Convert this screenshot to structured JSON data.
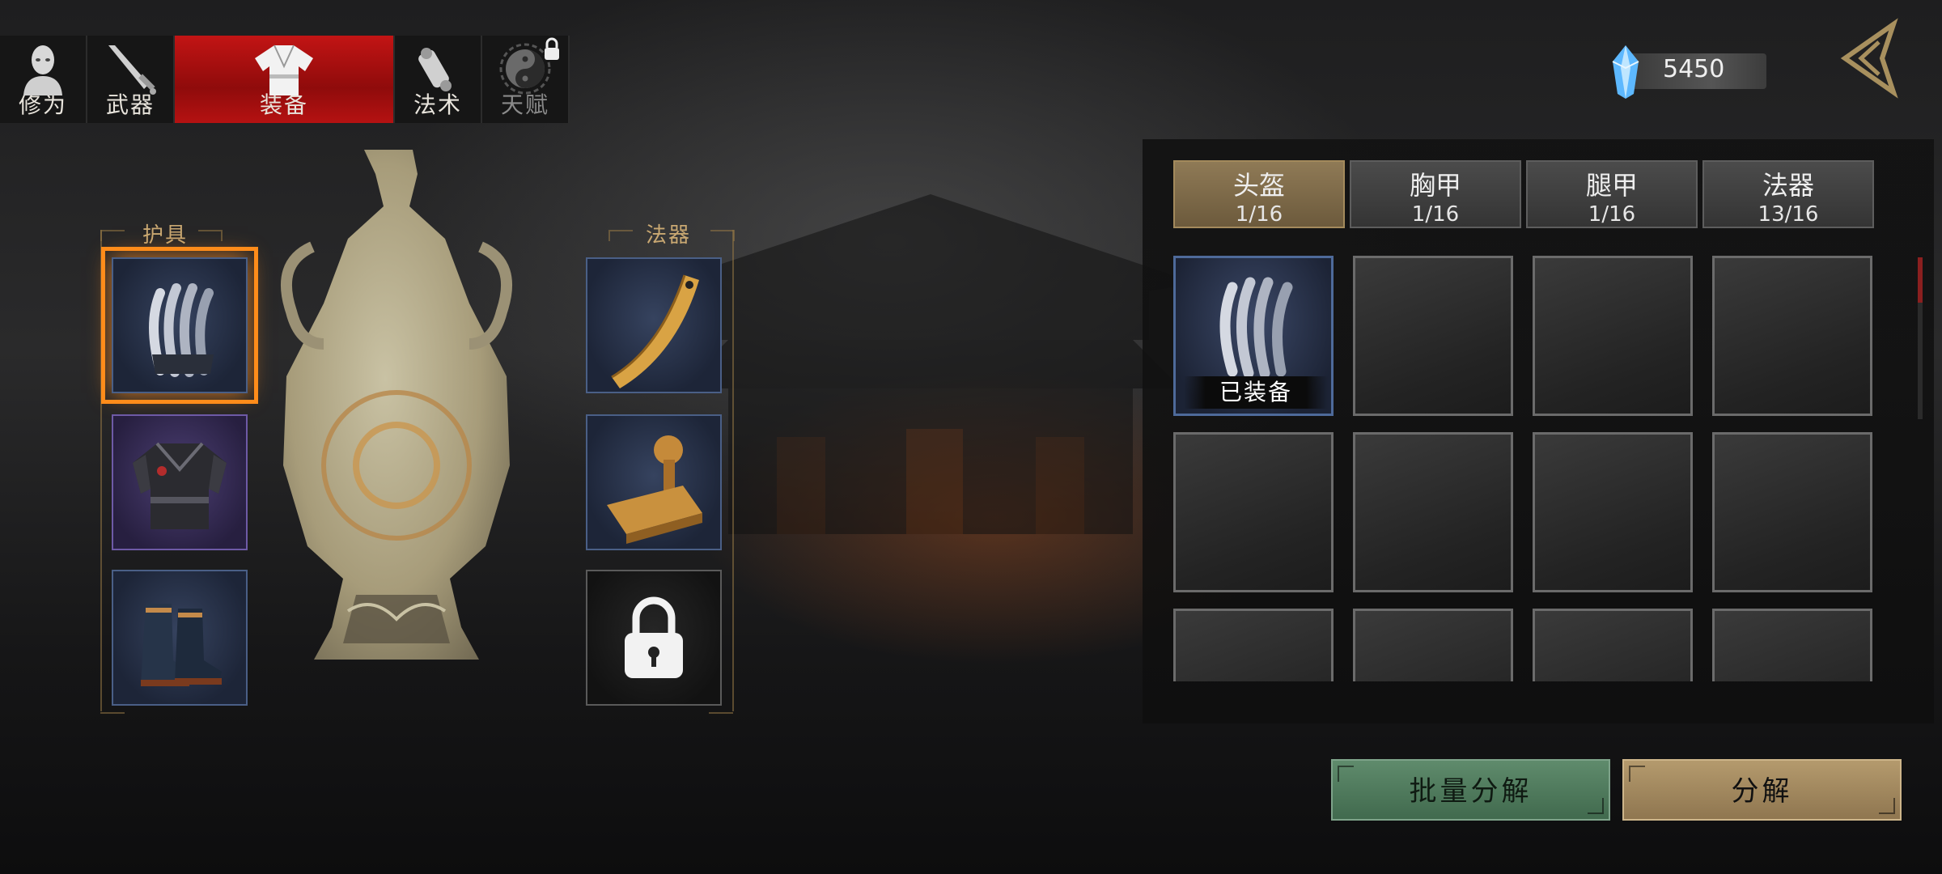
{
  "tabs": [
    {
      "label": "修为",
      "icon": "cultivator-bust-icon",
      "active": false,
      "locked": false
    },
    {
      "label": "武器",
      "icon": "sword-icon",
      "active": false,
      "locked": false
    },
    {
      "label": "装备",
      "icon": "robe-icon",
      "active": true,
      "locked": false
    },
    {
      "label": "法术",
      "icon": "scroll-icon",
      "active": false,
      "locked": false
    },
    {
      "label": "天赋",
      "icon": "yin-yang-icon",
      "active": false,
      "locked": true
    }
  ],
  "currency": {
    "icon": "blue-crystal-icon",
    "value": "5450"
  },
  "left": {
    "armor_title": "护具",
    "artifact_title": "法器",
    "armor_slots": [
      {
        "item": "helmet-claw-icon",
        "selected": true
      },
      {
        "item": "chest-armor-icon",
        "selected": false
      },
      {
        "item": "boots-icon",
        "selected": false
      }
    ],
    "artifact_slots": [
      {
        "item": "bamboo-scroll-icon",
        "locked": false
      },
      {
        "item": "seal-stamp-icon",
        "locked": false
      },
      {
        "item": "lock-icon",
        "locked": true
      }
    ]
  },
  "categories": [
    {
      "name": "头盔",
      "count": "1/16",
      "active": true
    },
    {
      "name": "胸甲",
      "count": "1/16",
      "active": false
    },
    {
      "name": "腿甲",
      "count": "1/16",
      "active": false
    },
    {
      "name": "法器",
      "count": "13/16",
      "active": false
    }
  ],
  "grid": {
    "equipped_label": "已装备"
  },
  "buttons": {
    "batch": "批量分解",
    "decompose": "分解"
  },
  "colors": {
    "active_tab": "#c21414",
    "selected_outline": "#ff8c1a",
    "batch_button": "#5f8b6c",
    "decompose_button": "#b49a6d"
  }
}
